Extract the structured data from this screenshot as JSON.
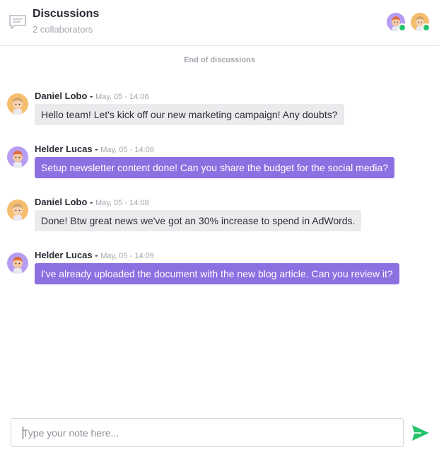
{
  "header": {
    "title": "Discussions",
    "subtitle": "2 collaborators",
    "icon": "chat-bubble-icon"
  },
  "end_note": "End of discussions",
  "messages": [
    {
      "author": "Daniel Lobo",
      "time": "May, 05 - 14:06",
      "text": "Hello team! Let's kick off our new marketing campaign! Any doubts?",
      "style": "grey"
    },
    {
      "author": "Helder Lucas",
      "time": "May, 05 - 14:06",
      "text": "Setup newsletter content done! Can you share the budget for the social media?",
      "style": "purple"
    },
    {
      "author": "Daniel Lobo",
      "time": "May, 05 - 14:08",
      "text": "Done! Btw great news we've got an 30% increase to spend in AdWords.",
      "style": "grey"
    },
    {
      "author": "Helder Lucas",
      "time": "May, 05 - 14:09",
      "text": "I've already uploaded the document with the new blog article. Can you review it?",
      "style": "purple"
    }
  ],
  "composer": {
    "placeholder": "Type your note here...",
    "value": ""
  },
  "colors": {
    "accent_purple": "#8c6fe0",
    "send_green": "#27c46b",
    "online_green": "#27c46b",
    "bubble_grey": "#ebebee"
  },
  "icons": {
    "send": "send-icon",
    "avatar_helder": "avatar-helder-icon",
    "avatar_daniel": "avatar-daniel-icon"
  }
}
